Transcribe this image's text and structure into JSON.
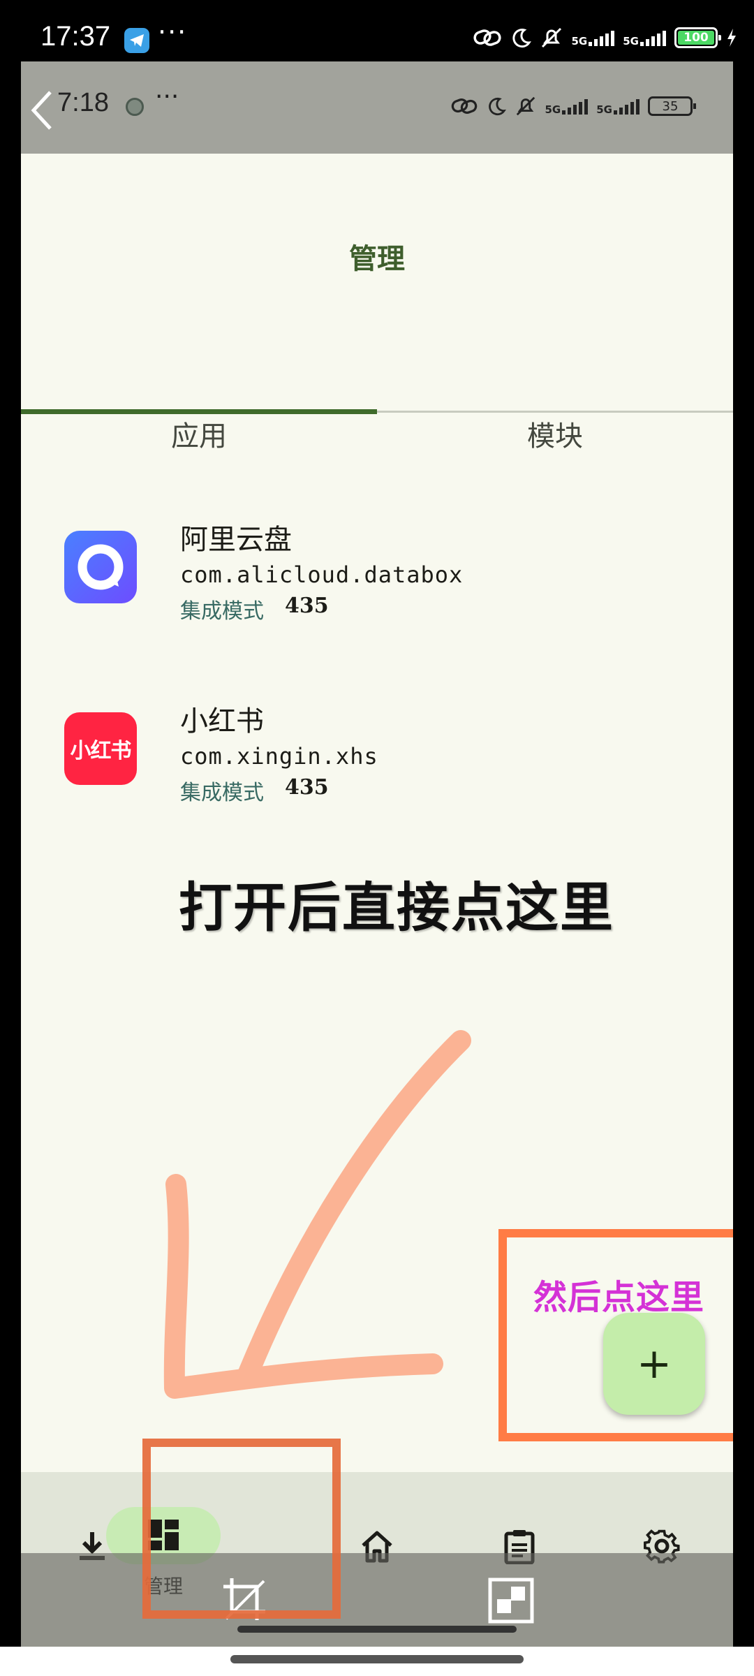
{
  "outer_status": {
    "time": "17:37",
    "dots": "···",
    "network": "5G",
    "battery": "100"
  },
  "inner_status": {
    "time": "7:18",
    "dots": "···",
    "network": "5G",
    "battery": "35"
  },
  "header": {
    "title": "管理"
  },
  "tabs": [
    {
      "label": "应用",
      "selected": true
    },
    {
      "label": "模块",
      "selected": false
    }
  ],
  "apps": [
    {
      "name": "阿里云盘",
      "package": "com.alicloud.databox",
      "mode": "集成模式",
      "version": "435"
    },
    {
      "name": "小红书",
      "package": "com.xingin.xhs",
      "mode": "集成模式",
      "version": "435",
      "icon_text": "小红书"
    }
  ],
  "annotations": {
    "main": "打开后直接点这里",
    "fab": "然后点这里"
  },
  "fab": {
    "symbol": "+"
  },
  "bottom_nav": [
    {
      "icon": "download-icon",
      "label": ""
    },
    {
      "icon": "dashboard-icon",
      "label": "管理",
      "selected": true
    },
    {
      "icon": "home-icon",
      "label": ""
    },
    {
      "icon": "clipboard-icon",
      "label": ""
    },
    {
      "icon": "settings-icon",
      "label": ""
    }
  ],
  "colors": {
    "accent": "#3f6b2b",
    "background": "#f8f9ef",
    "fab": "#c4edaa",
    "annotation_box": "#ff7c45",
    "annotation_text": "#d432d6"
  }
}
